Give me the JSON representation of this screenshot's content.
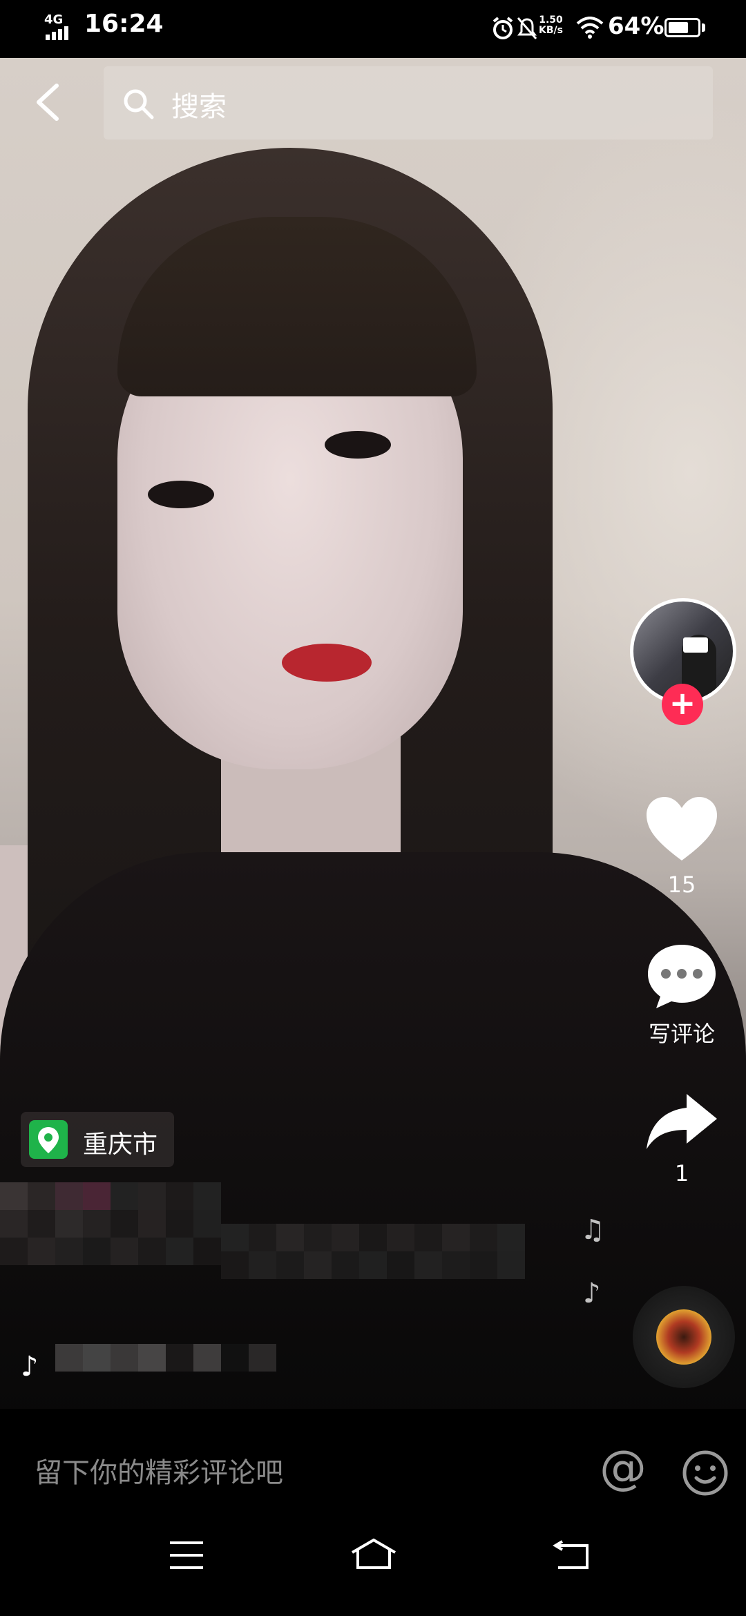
{
  "status_bar": {
    "network": "4G",
    "time": "16:24",
    "speed_value": "1.50",
    "speed_unit": "KB/s",
    "battery": "64%"
  },
  "top_bar": {
    "search_placeholder": "搜索"
  },
  "sidebar": {
    "like_count": "15",
    "comment_label": "写评论",
    "share_count": "1"
  },
  "location": {
    "label": "重庆市"
  },
  "comment_bar": {
    "placeholder": "留下你的精彩评论吧"
  },
  "colors": {
    "accent": "#fe2c55",
    "location_pin": "#1fb34a"
  }
}
